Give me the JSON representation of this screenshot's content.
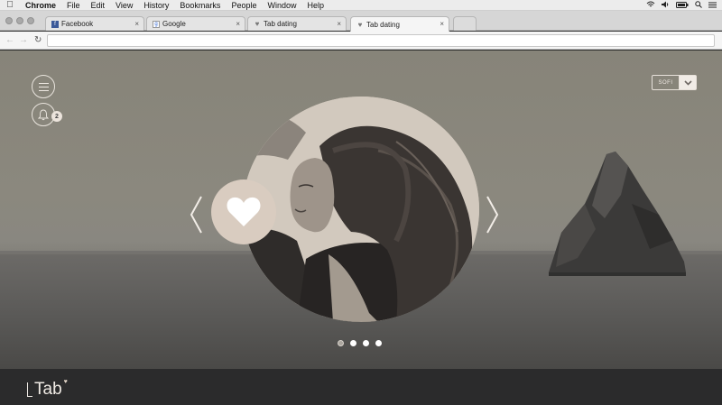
{
  "menubar": {
    "app": "Chrome",
    "items": [
      "File",
      "Edit",
      "View",
      "History",
      "Bookmarks",
      "People",
      "Window",
      "Help"
    ]
  },
  "tabs": [
    {
      "label": "Facebook",
      "favicon": "facebook-icon",
      "active": false
    },
    {
      "label": "Google",
      "favicon": "google-icon",
      "active": false
    },
    {
      "label": "Tab dating",
      "favicon": "heart-icon",
      "active": false
    },
    {
      "label": "Tab dating",
      "favicon": "heart-icon",
      "active": true
    }
  ],
  "omnibox": {
    "value": "",
    "placeholder": ""
  },
  "page": {
    "notifications_count": "2",
    "user_name": "SOFI",
    "like_icon": "heart-icon",
    "pagination": {
      "total": 4,
      "current": 1
    },
    "logo_text": "Tab"
  },
  "colors": {
    "accent": "#d9ccc0",
    "footer_bg": "#2b2b2c",
    "line": "#e9e4dd"
  }
}
